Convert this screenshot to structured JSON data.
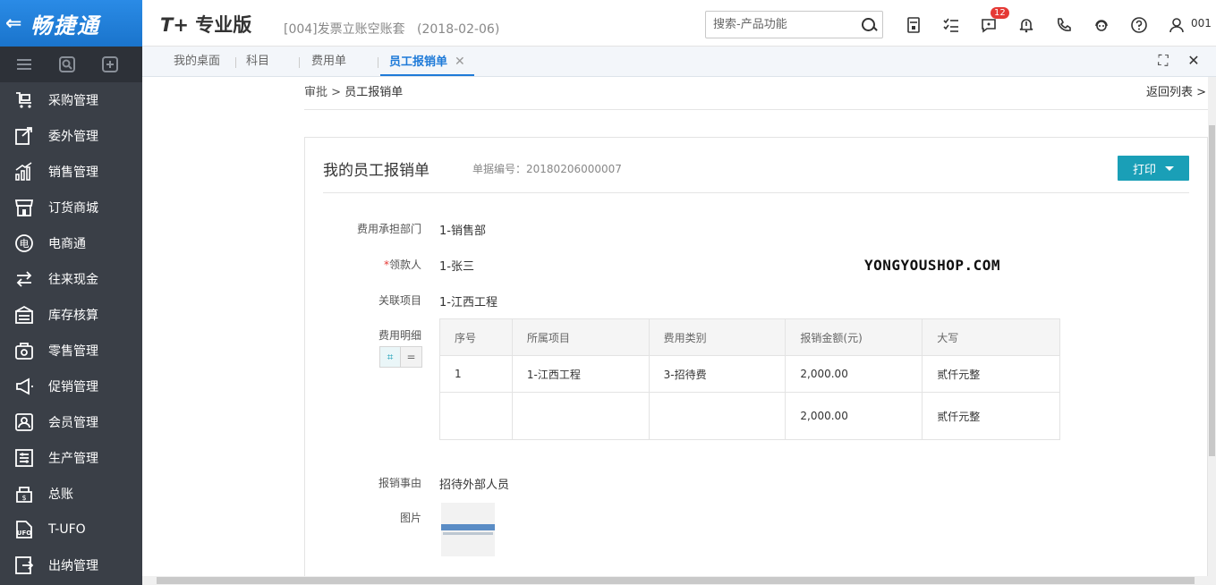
{
  "header": {
    "logo_text": "畅捷通",
    "product_prefix": "T+",
    "product_name": "专业版",
    "account": "[004]发票立账空账套",
    "account_date": "(2018-02-06)",
    "search_placeholder": "搜索-产品功能",
    "notification_count": "12",
    "user": "001"
  },
  "sidebar": {
    "items": [
      {
        "label": "采购管理",
        "icon": "cart-icon"
      },
      {
        "label": "委外管理",
        "icon": "outsource-icon"
      },
      {
        "label": "销售管理",
        "icon": "sales-chart-icon"
      },
      {
        "label": "订货商城",
        "icon": "store-icon"
      },
      {
        "label": "电商通",
        "icon": "ecommerce-icon"
      },
      {
        "label": "往来现金",
        "icon": "exchange-icon"
      },
      {
        "label": "库存核算",
        "icon": "inventory-icon"
      },
      {
        "label": "零售管理",
        "icon": "retail-icon"
      },
      {
        "label": "促销管理",
        "icon": "megaphone-icon"
      },
      {
        "label": "会员管理",
        "icon": "member-icon"
      },
      {
        "label": "生产管理",
        "icon": "production-icon"
      },
      {
        "label": "总账",
        "icon": "ledger-icon"
      },
      {
        "label": "T-UFO",
        "icon": "ufo-icon"
      },
      {
        "label": "出纳管理",
        "icon": "cashier-icon"
      }
    ]
  },
  "tabs": [
    {
      "label": "我的桌面"
    },
    {
      "label": "科目"
    },
    {
      "label": "费用单"
    },
    {
      "label": "员工报销单",
      "close": "✕"
    }
  ],
  "breadcrumb": {
    "parent": "审批",
    "sep": ">",
    "current": "员工报销单"
  },
  "back_list": "返回列表 >",
  "form": {
    "title": "我的员工报销单",
    "doc_no_label": "单据编号：",
    "doc_no": "20180206000007",
    "print_label": "打印",
    "dept_label": "费用承担部门",
    "dept_value": "1-销售部",
    "payee_required": "*",
    "payee_label": "领款人",
    "payee_value": "1-张三",
    "project_label": "关联项目",
    "project_value": "1-江西工程",
    "detail_label": "费用明细",
    "reason_label": "报销事由",
    "reason_value": "招待外部人员",
    "image_label": "图片",
    "watermark": "YONGYOUSHOP.COM"
  },
  "detail_table": {
    "headers": [
      "序号",
      "所属项目",
      "费用类别",
      "报销金额(元)",
      "大写"
    ],
    "rows": [
      [
        "1",
        "1-江西工程",
        "3-招待费",
        "2,000.00",
        "贰仟元整"
      ]
    ],
    "total": [
      "",
      "",
      "",
      "2,000.00",
      "贰仟元整"
    ]
  }
}
